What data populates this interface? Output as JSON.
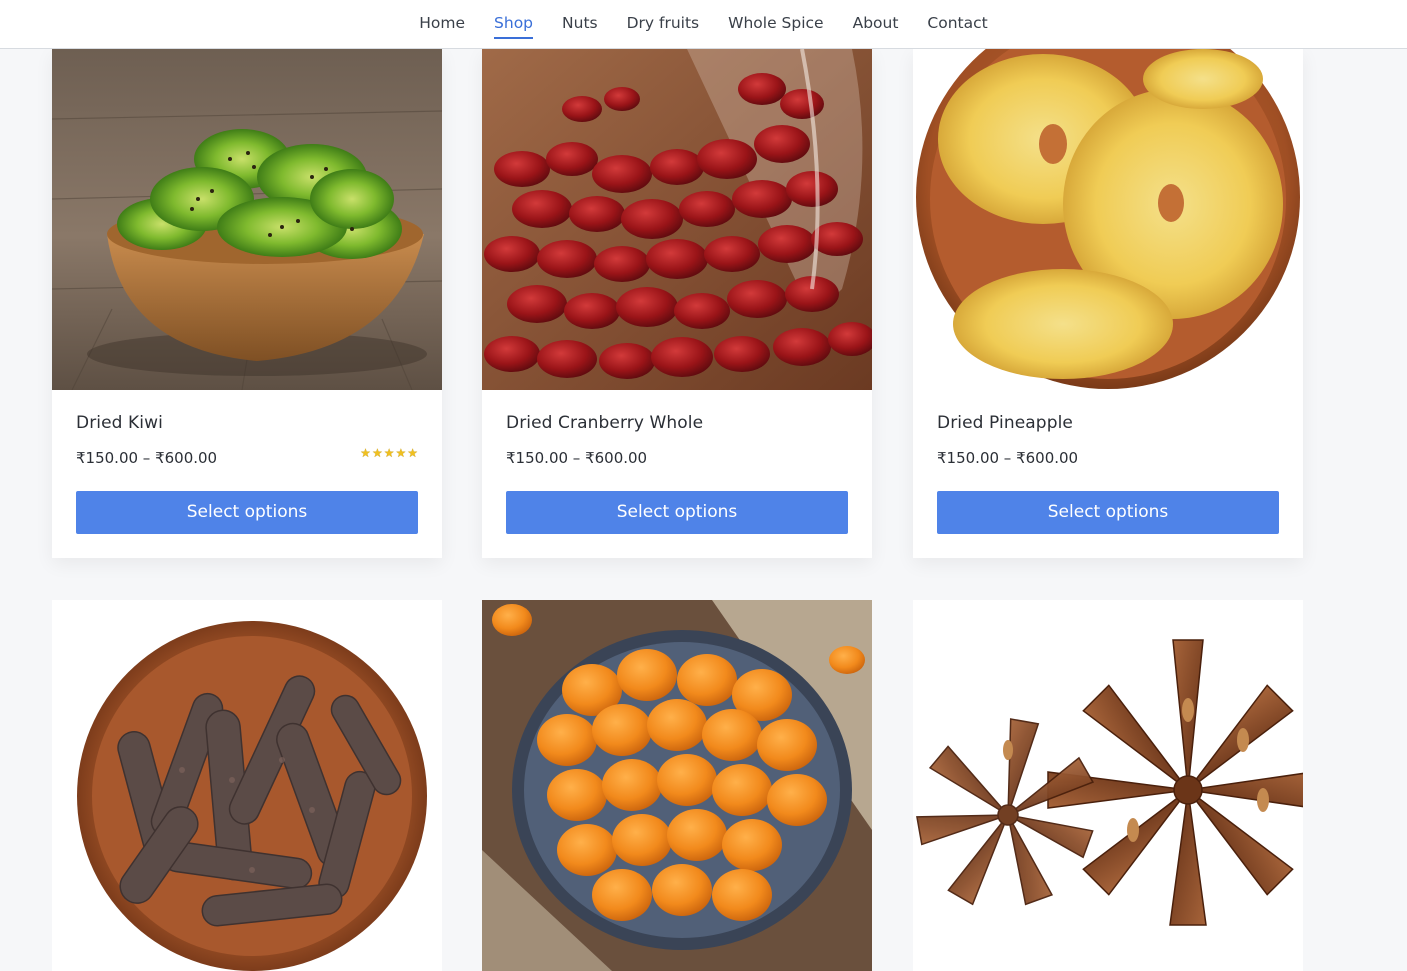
{
  "nav": {
    "items": [
      {
        "label": "Home"
      },
      {
        "label": "Shop"
      },
      {
        "label": "Nuts"
      },
      {
        "label": "Dry fruits"
      },
      {
        "label": "Whole Spice"
      },
      {
        "label": "About"
      },
      {
        "label": "Contact"
      }
    ],
    "active": "Shop"
  },
  "products": [
    {
      "title": "Dried Kiwi",
      "price": "₹150.00 – ₹600.00",
      "button": "Select options",
      "rating": 5,
      "image_icon": "dried-kiwi-image"
    },
    {
      "title": "Dried Cranberry Whole",
      "price": "₹150.00 – ₹600.00",
      "button": "Select options",
      "image_icon": "dried-cranberry-image"
    },
    {
      "title": "Dried Pineapple",
      "price": "₹150.00 – ₹600.00",
      "button": "Select options",
      "image_icon": "dried-pineapple-image"
    },
    {
      "image_icon": "long-pepper-image"
    },
    {
      "image_icon": "dried-apricot-image"
    },
    {
      "image_icon": "star-anise-image"
    }
  ],
  "colors": {
    "accent": "#4f83e8",
    "nav_active": "#3a6fd8",
    "page_bg": "#f6f7f9",
    "star": "#f0c020"
  }
}
